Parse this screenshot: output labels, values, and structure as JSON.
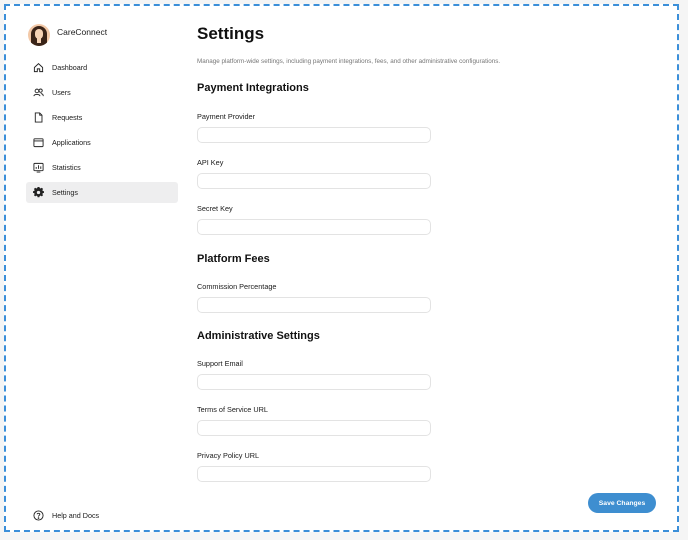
{
  "brand": {
    "name": "CareConnect"
  },
  "sidebar": {
    "items": [
      {
        "label": "Dashboard",
        "icon": "home-icon"
      },
      {
        "label": "Users",
        "icon": "users-icon"
      },
      {
        "label": "Requests",
        "icon": "document-icon"
      },
      {
        "label": "Applications",
        "icon": "window-icon"
      },
      {
        "label": "Statistics",
        "icon": "chart-icon"
      },
      {
        "label": "Settings",
        "icon": "gear-icon",
        "active": true
      }
    ],
    "help": {
      "label": "Help and Docs",
      "icon": "help-icon"
    }
  },
  "page": {
    "title": "Settings",
    "description": "Manage platform-wide settings, including payment integrations, fees, and other administrative configurations."
  },
  "sections": {
    "payment": {
      "title": "Payment Integrations",
      "provider": {
        "label": "Payment Provider",
        "value": ""
      },
      "api_key": {
        "label": "API Key",
        "value": ""
      },
      "secret_key": {
        "label": "Secret Key",
        "value": ""
      }
    },
    "fees": {
      "title": "Platform Fees",
      "commission": {
        "label": "Commission Percentage",
        "value": ""
      }
    },
    "admin": {
      "title": "Administrative Settings",
      "support_email": {
        "label": "Support Email",
        "value": ""
      },
      "tos_url": {
        "label": "Terms of Service URL",
        "value": ""
      },
      "privacy_url": {
        "label": "Privacy Policy URL",
        "value": ""
      }
    }
  },
  "actions": {
    "save_label": "Save Changes"
  },
  "colors": {
    "accent": "#3e8ed0",
    "frame_border": "#3b8fd9",
    "active_bg": "#eeeeef"
  }
}
